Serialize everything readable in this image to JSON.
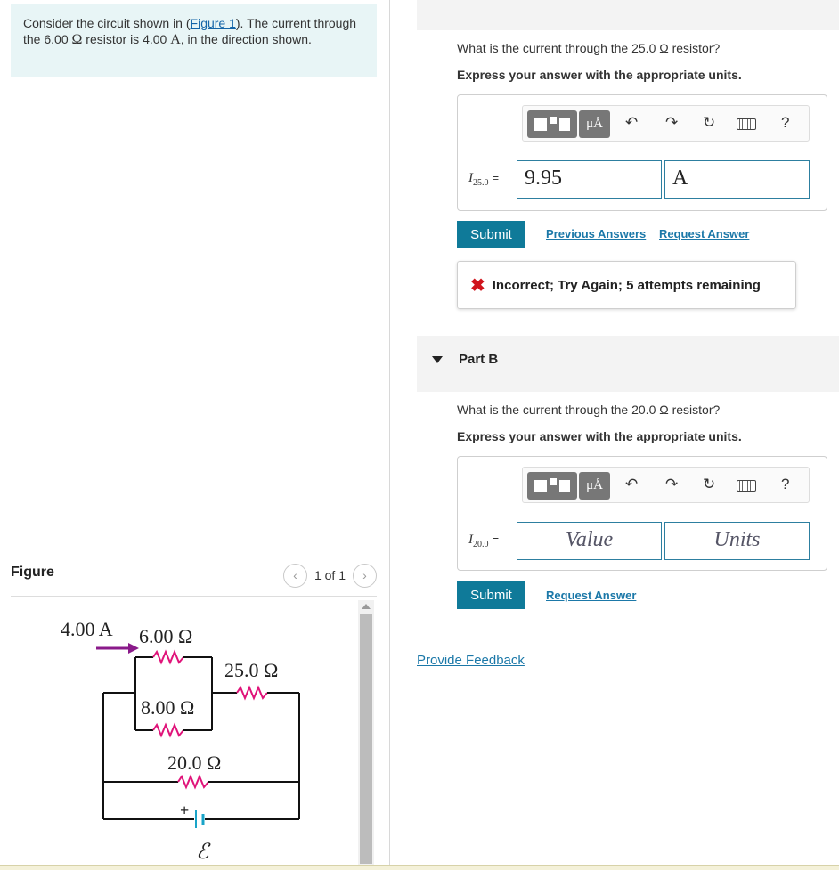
{
  "intro": {
    "prefix": "Consider the circuit shown in (",
    "figure_link": "Figure 1",
    "mid": "). The current through the 6.00 ",
    "ohm": "Ω",
    "mid2": " resistor is 4.00 ",
    "amp": "A",
    "suffix": ", in the direction shown."
  },
  "figure": {
    "label": "Figure",
    "pager_text": "1 of 1",
    "prev_icon": "chevron-left-icon",
    "next_icon": "chevron-right-icon"
  },
  "circuit": {
    "current_label": "4.00 A",
    "r6": "6.00 Ω",
    "r25": "25.0 Ω",
    "r8": "8.00 Ω",
    "r20": "20.0 Ω",
    "plus": "+",
    "emf": "ℰ"
  },
  "partA": {
    "question": "What is the current through the 25.0 Ω resistor?",
    "units_prompt": "Express your answer with the appropriate units.",
    "var_main": "I",
    "var_sub": "25.0",
    "equals": "=",
    "value": "9.95",
    "unit": "A",
    "submit_label": "Submit",
    "prev_answers_label": "Previous Answers",
    "request_answer_label": "Request Answer",
    "feedback": "Incorrect; Try Again; 5 attempts remaining"
  },
  "toolbar": {
    "units_label": "μÅ",
    "undo_icon": "undo-icon",
    "redo_icon": "redo-icon",
    "reset_icon": "reset-icon",
    "keyboard_icon": "keyboard-icon",
    "help_label": "?"
  },
  "partB": {
    "title": "Part B",
    "question": "What is the current through the 20.0 Ω resistor?",
    "units_prompt": "Express your answer with the appropriate units.",
    "var_main": "I",
    "var_sub": "20.0",
    "equals": "=",
    "value_placeholder": "Value",
    "units_placeholder": "Units",
    "submit_label": "Submit",
    "request_answer_label": "Request Answer"
  },
  "provide_feedback_label": "Provide Feedback",
  "colors": {
    "submit": "#0f7a99",
    "link": "#1b78a8",
    "incorrect": "#d0141c",
    "resistor": "#e0147a",
    "arrow": "#8a1a8a"
  }
}
